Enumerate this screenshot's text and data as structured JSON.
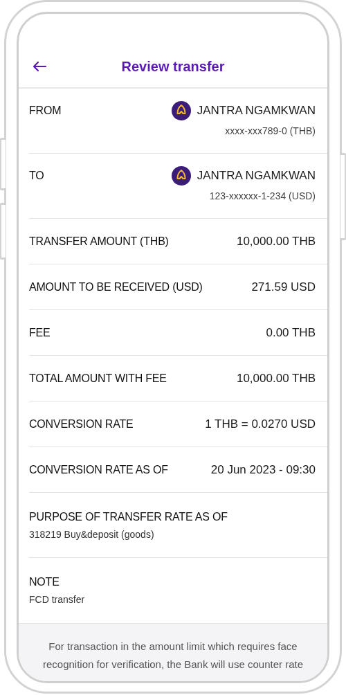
{
  "header": {
    "title": "Review transfer"
  },
  "rows": [
    {
      "kind": "account",
      "label": "FROM",
      "name": "JANTRA NGAMKWAN",
      "account": "xxxx-xxx789-0 (THB)"
    },
    {
      "kind": "account",
      "label": "TO",
      "name": "JANTRA NGAMKWAN",
      "account": "123-xxxxxx-1-234 (USD)"
    },
    {
      "kind": "inline",
      "label": "TRANSFER AMOUNT (THB)",
      "value": "10,000.00 THB"
    },
    {
      "kind": "inline",
      "label": "AMOUNT TO BE RECEIVED (USD)",
      "value": "271.59 USD"
    },
    {
      "kind": "inline",
      "label": "FEE",
      "value": "0.00 THB"
    },
    {
      "kind": "inline",
      "label": "TOTAL AMOUNT WITH FEE",
      "value": "10,000.00 THB"
    },
    {
      "kind": "inline",
      "label": "CONVERSION RATE",
      "value": "1 THB = 0.0270 USD"
    },
    {
      "kind": "inline",
      "label": "CONVERSION RATE AS OF",
      "value": "20 Jun 2023 - 09:30"
    },
    {
      "kind": "stacked",
      "label": "PURPOSE OF TRANSFER RATE AS OF",
      "value": "318219 Buy&deposit (goods)"
    },
    {
      "kind": "stacked",
      "label": "NOTE",
      "value": "FCD transfer"
    }
  ],
  "notice": "For transaction in the amount limit which requires face recognition for verification, the Bank will use counter rate"
}
